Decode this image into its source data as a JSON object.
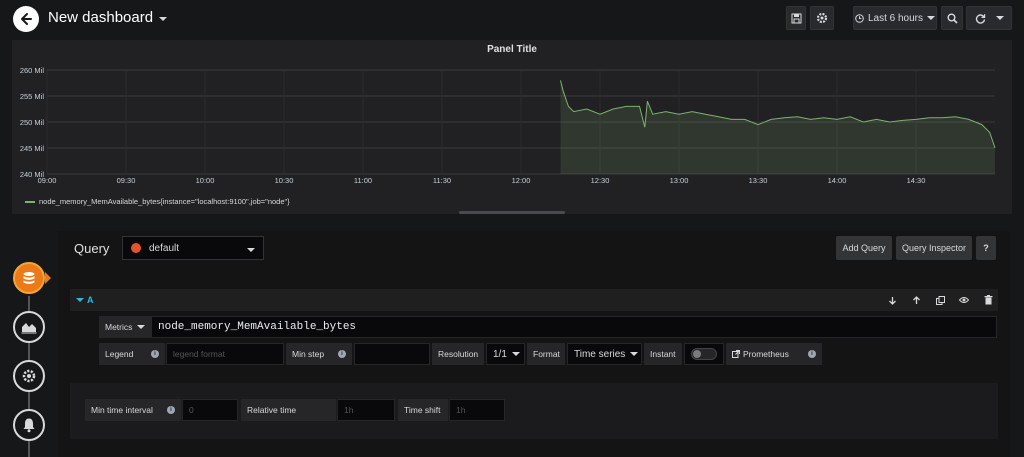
{
  "header": {
    "title": "New dashboard",
    "time_range": "Last 6 hours"
  },
  "panel": {
    "title": "Panel Title",
    "legend": "node_memory_MemAvailable_bytes{instance=\"localhost:9100\",job=\"node\"}"
  },
  "chart_data": {
    "type": "area",
    "title": "Panel Title",
    "y_ticks": [
      "260 Mil",
      "255 Mil",
      "250 Mil",
      "245 Mil",
      "240 Mil"
    ],
    "x_ticks": [
      "09:00",
      "09:30",
      "10:00",
      "10:30",
      "11:00",
      "11:30",
      "12:00",
      "12:30",
      "13:00",
      "13:30",
      "14:00",
      "14:30"
    ],
    "ylim": [
      240,
      260
    ],
    "yunit": "Mil",
    "xlim": [
      "09:00",
      "15:00"
    ],
    "series": [
      {
        "name": "node_memory_MemAvailable_bytes{instance=\"localhost:9100\",job=\"node\"}",
        "color": "#7eb26d",
        "x": [
          "12:15",
          "12:16",
          "12:18",
          "12:20",
          "12:25",
          "12:30",
          "12:35",
          "12:40",
          "12:45",
          "12:47",
          "12:48",
          "12:50",
          "12:55",
          "13:00",
          "13:05",
          "13:10",
          "13:15",
          "13:20",
          "13:25",
          "13:30",
          "13:35",
          "13:40",
          "13:45",
          "13:50",
          "13:55",
          "14:00",
          "14:05",
          "14:10",
          "14:15",
          "14:20",
          "14:25",
          "14:30",
          "14:35",
          "14:40",
          "14:45",
          "14:50",
          "14:55",
          "14:58",
          "15:00"
        ],
        "y": [
          258,
          256,
          253,
          252,
          252.5,
          251.5,
          252.5,
          253,
          253,
          249,
          254,
          251.5,
          252,
          251.5,
          252,
          251.5,
          251,
          250.5,
          250.5,
          249.5,
          250.5,
          250.8,
          251,
          250.5,
          250.8,
          250.5,
          251,
          250,
          250.5,
          250,
          250.3,
          250.5,
          250.8,
          250.8,
          251,
          250.5,
          249.5,
          248,
          245
        ]
      }
    ],
    "grid": true,
    "legend_position": "bottom-left"
  },
  "editor": {
    "tab_label": "Query",
    "datasource": "default",
    "add_query": "Add Query",
    "query_inspector": "Query Inspector",
    "help": "?",
    "query": {
      "ref_id": "A",
      "metrics_label": "Metrics",
      "expression": "node_memory_MemAvailable_bytes",
      "legend_label": "Legend",
      "legend_placeholder": "legend format",
      "min_step_label": "Min step",
      "min_step_value": "",
      "resolution_label": "Resolution",
      "resolution_value": "1/1",
      "format_label": "Format",
      "format_value": "Time series",
      "instant_label": "Instant",
      "prometheus_link": "Prometheus"
    },
    "options": {
      "min_interval_label": "Min time interval",
      "min_interval_placeholder": "0",
      "relative_time_label": "Relative time",
      "relative_time_placeholder": "1h",
      "time_shift_label": "Time shift",
      "time_shift_placeholder": "1h"
    }
  },
  "colors": {
    "accent": "#eb7b18",
    "series": "#7eb26d",
    "query_ref": "#33b5e5"
  }
}
